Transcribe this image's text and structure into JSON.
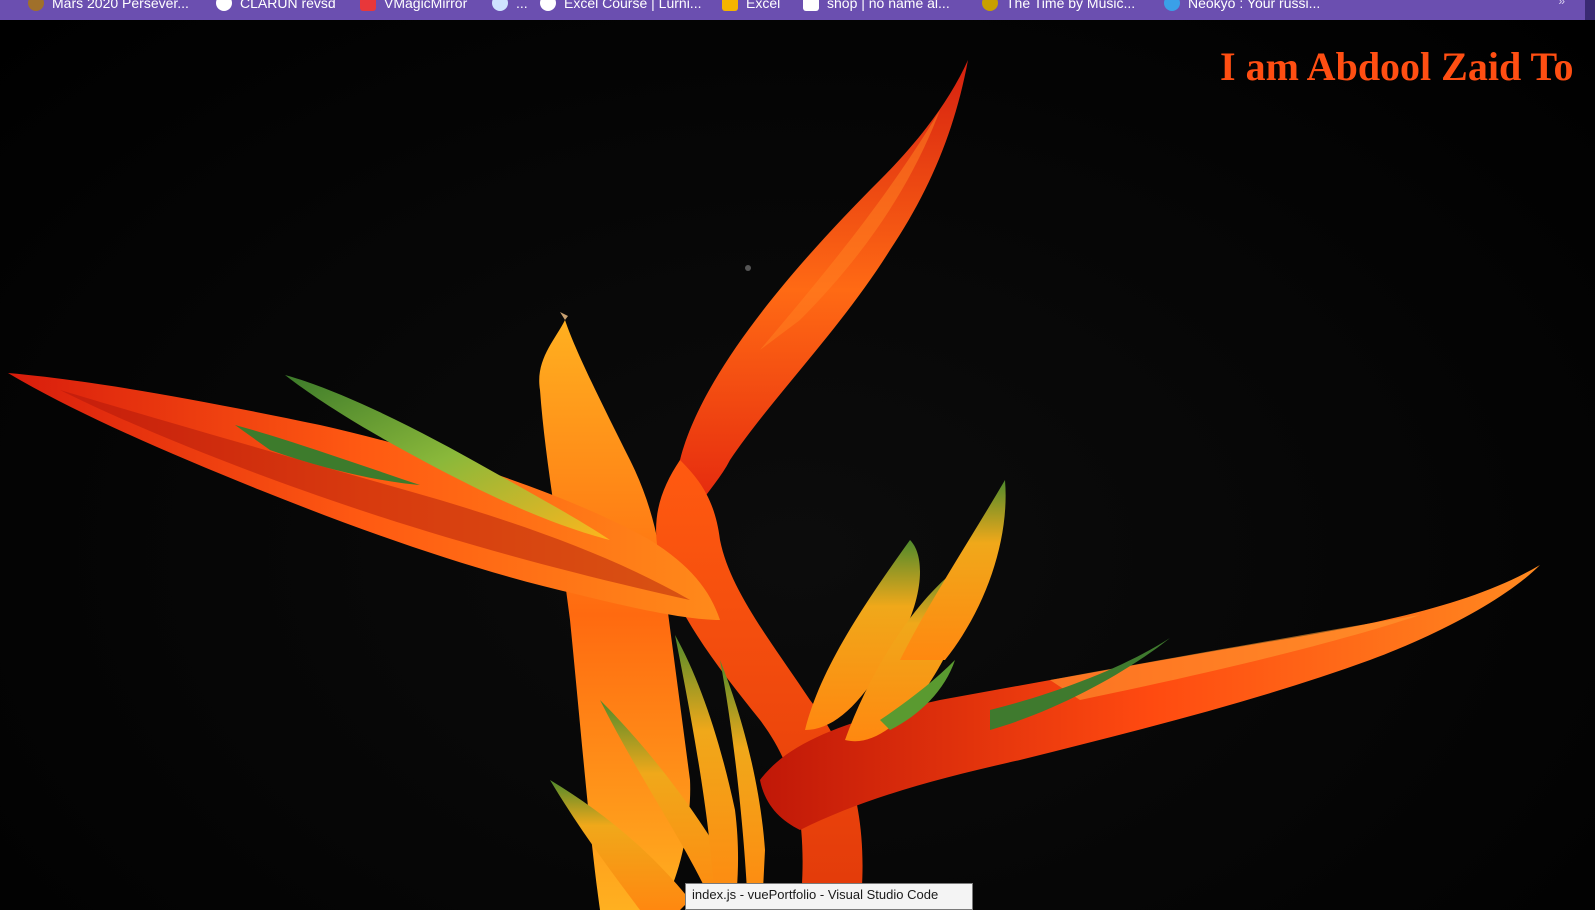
{
  "bookmarks_bar": {
    "background": "#6b4fb0",
    "items": [
      {
        "label": "Mars 2020 Persever...",
        "icon": "mars-favicon-icon",
        "color": "#a0702a"
      },
      {
        "label": "CLARUN revsd",
        "icon": "clarun-favicon-icon",
        "color": "#ffffff"
      },
      {
        "label": "VMagicMirror",
        "icon": "vmagicmirror-favicon-icon",
        "color": "#e8373a"
      },
      {
        "label": "...",
        "icon": "twitter-bird-icon",
        "color": "#cfe3ff"
      },
      {
        "label": "Excel Course | Lurni...",
        "icon": "excel-course-favicon-icon",
        "color": "#ffffff"
      },
      {
        "label": "Excel",
        "icon": "excel-grid-icon",
        "color": "#f4b400"
      },
      {
        "label": "shop | no name al...",
        "icon": "shop-favicon-icon",
        "color": "#ffffff"
      },
      {
        "label": "The Time by Music...",
        "icon": "music-favicon-icon",
        "color": "#c8a000"
      },
      {
        "label": "Neokyo : Your russi...",
        "icon": "neokyo-favicon-icon",
        "color": "#3aa0e8"
      }
    ],
    "overflow_icon": "chevron-double-right-icon"
  },
  "hero": {
    "title": "I am Abdool Zaid To",
    "title_color": "#ff4e12",
    "background": "#000000",
    "image": "bird-of-paradise-flower"
  },
  "taskbar_tooltip": {
    "text": "index.js - vuePortfolio - Visual Studio Code"
  }
}
